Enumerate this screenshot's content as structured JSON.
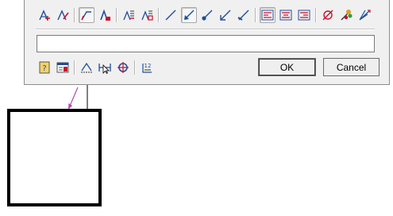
{
  "toolbar1": {
    "icons": [
      "text-add-icon",
      "text-edit-icon",
      "leader-text-icon",
      "text-bold-leader-icon",
      "text-stack-icon",
      "text-stack-box-icon",
      "line-plain-icon",
      "leader-arrow-icon",
      "leader-dot-icon",
      "leader-open-arrow-icon",
      "leader-slash-icon",
      "align-left-icon",
      "align-center-icon",
      "align-right-icon",
      "diameter-symbol-icon",
      "color-fill-icon",
      "multi-leader-icon"
    ]
  },
  "toolbar2": {
    "icons": [
      "help-book-icon",
      "property-editor-icon",
      "ruler-scale-icon",
      "move-cursor-icon",
      "target-snap-icon",
      "superscript-icon"
    ]
  },
  "text_field": {
    "value": ""
  },
  "buttons": {
    "ok": "OK",
    "cancel": "Cancel"
  },
  "colors": {
    "dialog_bg": "#f0f0f0",
    "leader": "#b04ab0",
    "accent_red": "#c8102e",
    "icon_blue": "#1f4e9c"
  }
}
